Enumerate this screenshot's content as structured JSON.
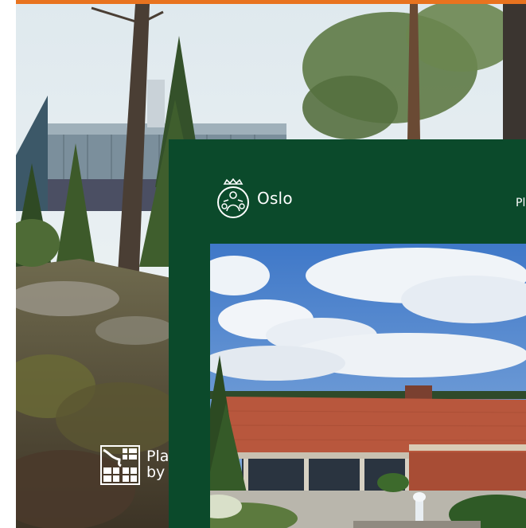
{
  "background": {
    "logo_line1": "Pla",
    "logo_line2": "by",
    "logo_icon": "city-plan-grid-icon"
  },
  "card": {
    "brand_name": "Oslo",
    "brand_icon": "oslo-emblem-icon",
    "nav_partial": "Pl"
  },
  "colors": {
    "accent": "#e8731f",
    "card_green": "#0b4a2b",
    "text_on_dark": "#ffffff"
  }
}
